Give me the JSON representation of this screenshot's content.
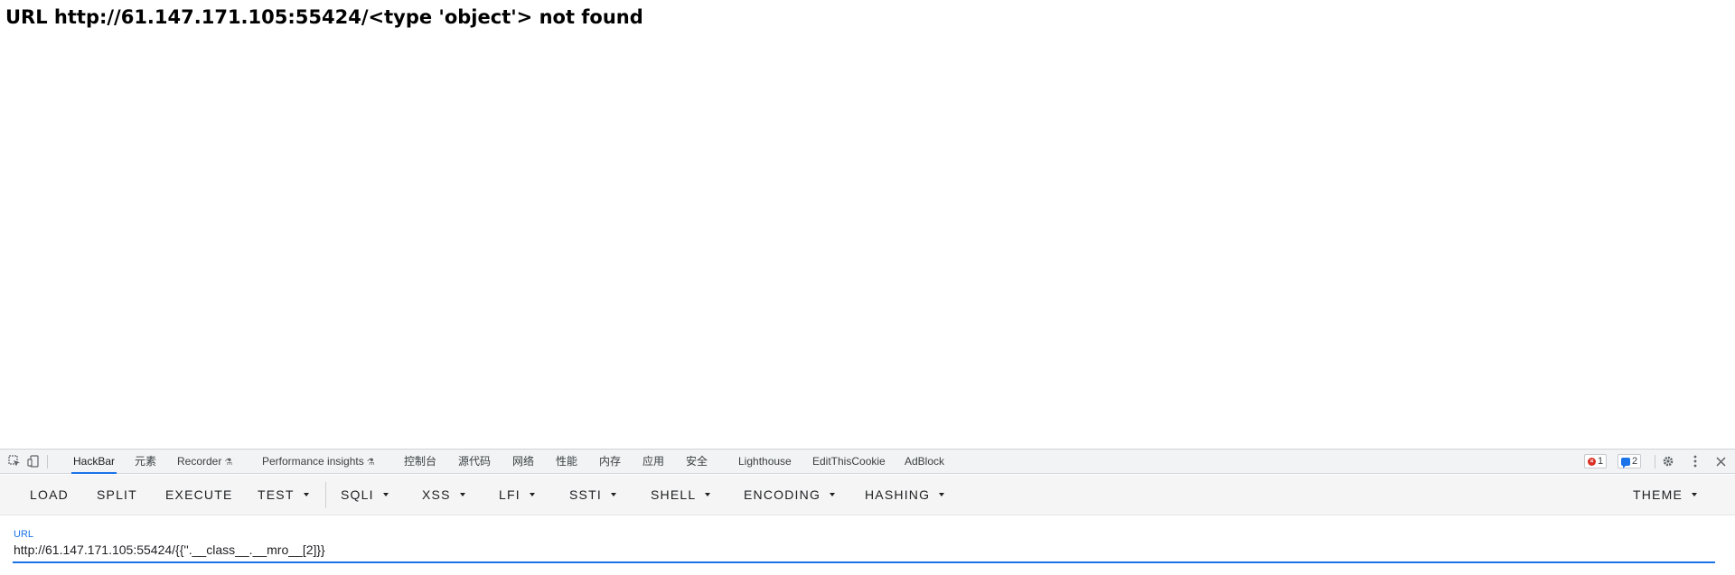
{
  "page": {
    "heading": "URL http://61.147.171.105:55424/<type 'object'> not found"
  },
  "devtools": {
    "toolbar_icons": [
      "inspect-element-icon",
      "device-toolbar-icon"
    ],
    "tabs": [
      {
        "label": "HackBar",
        "active": true
      },
      {
        "label": "元素"
      },
      {
        "label": "Recorder",
        "experimental": true
      },
      {
        "label": "Performance insights",
        "experimental": true
      },
      {
        "label": "控制台"
      },
      {
        "label": "源代码"
      },
      {
        "label": "网络"
      },
      {
        "label": "性能"
      },
      {
        "label": "内存"
      },
      {
        "label": "应用"
      },
      {
        "label": "安全"
      },
      {
        "label": "Lighthouse"
      },
      {
        "label": "EditThisCookie"
      },
      {
        "label": "AdBlock"
      }
    ],
    "error_count": "1",
    "message_count": "2",
    "right_icons": [
      "gear-icon",
      "more-vert-icon",
      "close-icon"
    ]
  },
  "hackbar": {
    "buttons": [
      {
        "label": "LOAD",
        "dropdown": false
      },
      {
        "label": "SPLIT",
        "dropdown": false
      },
      {
        "label": "EXECUTE",
        "dropdown": false
      },
      {
        "label": "TEST",
        "dropdown": true
      },
      {
        "label": "SQLI",
        "dropdown": true
      },
      {
        "label": "XSS",
        "dropdown": true
      },
      {
        "label": "LFI",
        "dropdown": true
      },
      {
        "label": "SSTI",
        "dropdown": true
      },
      {
        "label": "SHELL",
        "dropdown": true
      },
      {
        "label": "ENCODING",
        "dropdown": true
      },
      {
        "label": "HASHING",
        "dropdown": true
      }
    ],
    "theme_label": "THEME",
    "url_label": "URL",
    "url_value": "http://61.147.171.105:55424/{{''.__class__.__mro__[2]}}"
  },
  "colors": {
    "accent": "#1a73e8",
    "error": "#d93025"
  }
}
